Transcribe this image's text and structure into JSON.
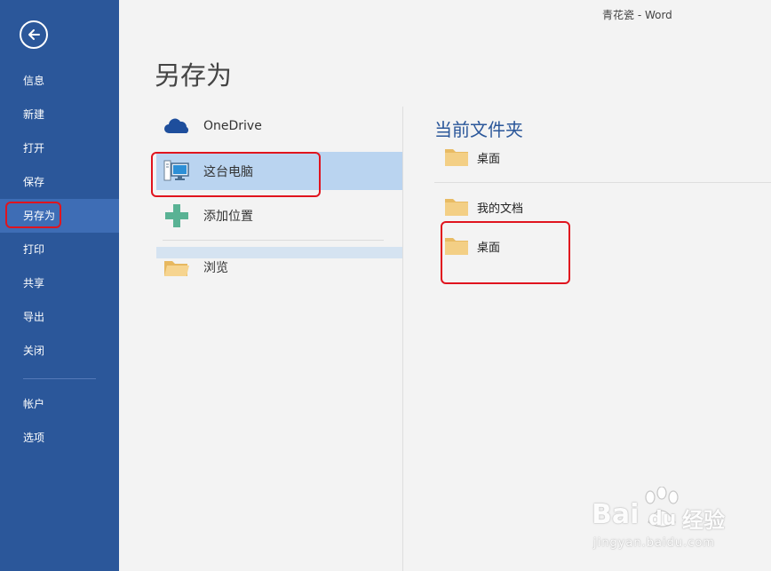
{
  "window": {
    "title": "青花瓷 - Word"
  },
  "colors": {
    "sidebar": "#2b579a",
    "sidebar_active": "#3e6db5",
    "accent": "#2b579a",
    "selected": "#bad4f0",
    "highlight": "#e0141e",
    "folder": "#f0c674"
  },
  "sidebar": {
    "back_icon": "arrow-left-circle-icon",
    "items": [
      {
        "label": "信息"
      },
      {
        "label": "新建"
      },
      {
        "label": "打开"
      },
      {
        "label": "保存"
      },
      {
        "label": "另存为",
        "active": true
      },
      {
        "label": "打印"
      },
      {
        "label": "共享"
      },
      {
        "label": "导出"
      },
      {
        "label": "关闭"
      },
      {
        "label": "帐户"
      },
      {
        "label": "选项"
      }
    ]
  },
  "page": {
    "title": "另存为"
  },
  "locations": [
    {
      "label": "OneDrive",
      "icon": "cloud-icon"
    },
    {
      "label": "这台电脑",
      "icon": "computer-icon",
      "selected": true
    },
    {
      "label": "添加位置",
      "icon": "plus-icon"
    },
    {
      "label": "浏览",
      "icon": "folder-open-icon"
    }
  ],
  "folders": {
    "current_title": "当前文件夹",
    "current": [
      {
        "label": "桌面"
      }
    ],
    "recent": [
      {
        "label": "我的文档"
      },
      {
        "label": "桌面"
      }
    ]
  },
  "watermark": {
    "brand": "Bai",
    "brand2": "du",
    "suffix": "经验",
    "url": "jingyan.baidu.com"
  }
}
